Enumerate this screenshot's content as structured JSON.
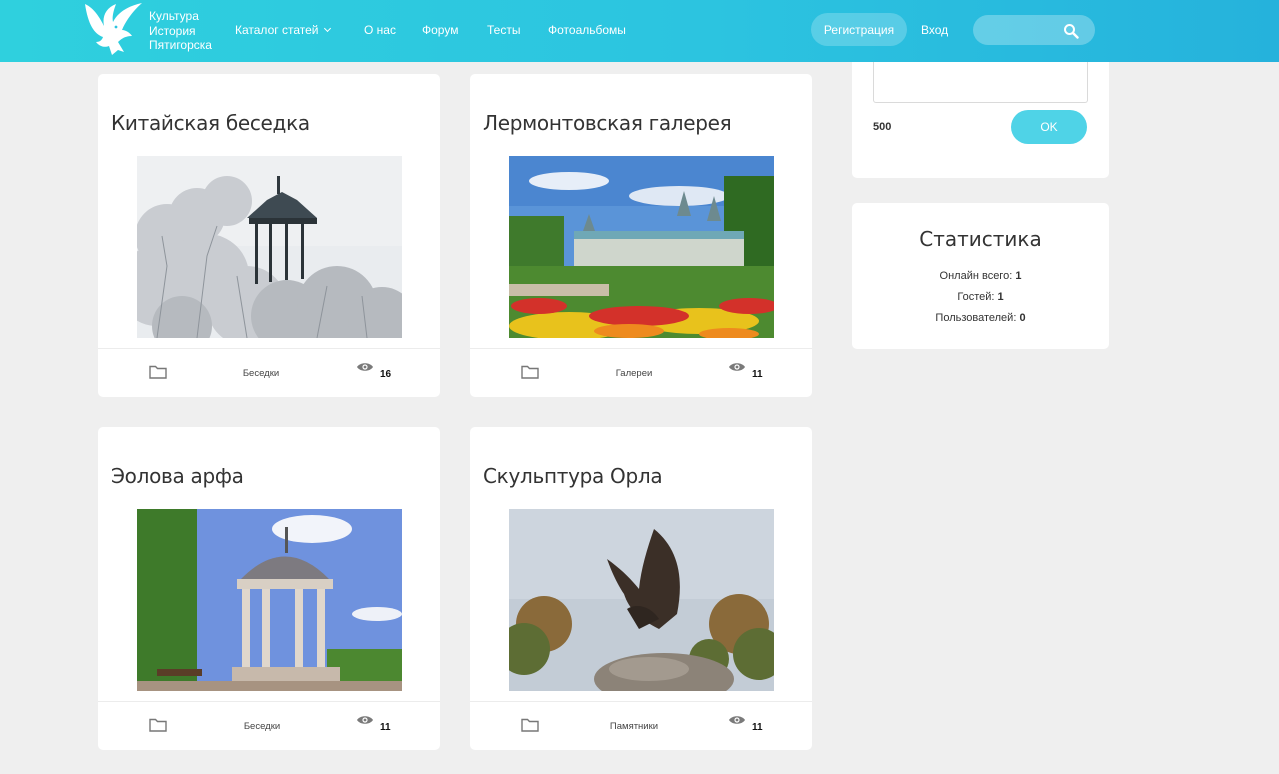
{
  "header": {
    "logo_lines": [
      "Культура",
      "История",
      "Пятигорска"
    ],
    "nav": [
      "Каталог статей",
      "О нас",
      "Форум",
      "Тесты",
      "Фотоальбомы"
    ],
    "register_label": "Регистрация",
    "login_label": "Вход",
    "search_placeholder": ""
  },
  "cards": [
    {
      "title": "Китайская беседка",
      "category": "Беседки",
      "views": "16",
      "image": "winter-gazebo"
    },
    {
      "title": "Лермонтовская галерея",
      "category": "Галереи",
      "views": "11",
      "image": "gallery-flowers"
    },
    {
      "title": "Эолова арфа",
      "category": "Беседки",
      "views": "11",
      "image": "rotunda"
    },
    {
      "title": "Скульптура Орла",
      "category": "Памятники",
      "views": "11",
      "image": "eagle-sculpture"
    }
  ],
  "sidebar": {
    "char_count": "500",
    "ok_label": "OK",
    "stats_title": "Статистика",
    "stats": [
      {
        "label": "Онлайн всего:",
        "value": "1"
      },
      {
        "label": "Гостей:",
        "value": "1"
      },
      {
        "label": "Пользователей:",
        "value": "0"
      }
    ]
  },
  "colors": {
    "header": "#2cc4e0",
    "accent": "#4fd3e7",
    "background": "#efefef"
  }
}
